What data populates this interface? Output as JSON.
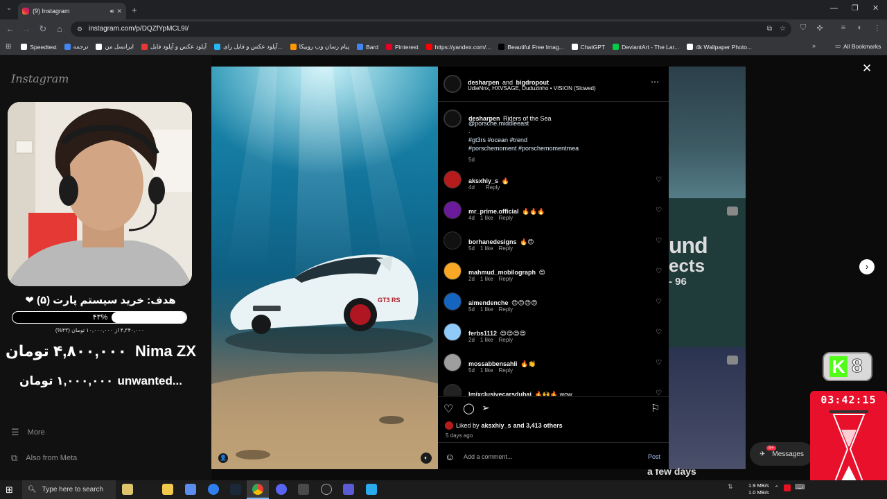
{
  "browser": {
    "tab_title": "(9) Instagram",
    "url": "instagram.com/p/DQZfYpMCL9I/",
    "bookmarks": [
      {
        "label": "Speedtest",
        "color": "#ffffff"
      },
      {
        "label": "ترجمه",
        "color": "#4285f4"
      },
      {
        "label": "ایرانسل من",
        "color": "#ffffff"
      },
      {
        "label": "آپلود عکس و آپلود فایل",
        "color": "#e53935"
      },
      {
        "label": "آپلود عکس و فایل رای...",
        "color": "#29b6f6"
      },
      {
        "label": "پیام رسان وب روبیکا",
        "color": "#ff9800"
      },
      {
        "label": "Bard",
        "color": "#4285f4"
      },
      {
        "label": "Pinterest",
        "color": "#e60023"
      },
      {
        "label": "https://yandex.com/...",
        "color": "#ff0000"
      },
      {
        "label": "Beautiful Free Imag...",
        "color": "#000000"
      },
      {
        "label": "ChatGPT",
        "color": "#ffffff"
      },
      {
        "label": "DeviantArt - The Lar...",
        "color": "#05cc47"
      },
      {
        "label": "4k Wallpaper Photo...",
        "color": "#ffffff"
      }
    ],
    "all_bookmarks_label": "All Bookmarks"
  },
  "instagram": {
    "logo_text": "Instagram",
    "sidebar": {
      "more_label": "More",
      "meta_label": "Also from Meta"
    },
    "post": {
      "header_users": "desharpen",
      "header_and": "and",
      "header_user2": "bigdropout",
      "audio_line": "UdieNnx, HXVSAGE, Duduzinho • VISION (Slowed)",
      "caption_user": "desharpen",
      "caption_text": "Riders of the Sea",
      "caption_mention": "@porsche.middleeast",
      "caption_dot": ".",
      "caption_tags1": "#gt3rs #ocean #trend",
      "caption_tags2": "#porschemoment #porschemomentmea",
      "caption_age": "5d",
      "comments": [
        {
          "user": "aksxhiy_s",
          "text": "🔥",
          "age": "4d",
          "likes": "",
          "reply": "Reply",
          "color": "#b71c1c"
        },
        {
          "user": "mr_prime.official",
          "text": "🔥🔥🔥",
          "age": "4d",
          "likes": "1 like",
          "reply": "Reply",
          "color": "#6a1b9a"
        },
        {
          "user": "borhanedesigns",
          "text": "🔥😍",
          "age": "5d",
          "likes": "1 like",
          "reply": "Reply",
          "color": "#111111"
        },
        {
          "user": "mahmud_mobilograph",
          "text": "😍",
          "age": "2d",
          "likes": "1 like",
          "reply": "Reply",
          "color": "#f9a825"
        },
        {
          "user": "aimendenche",
          "text": "😍😍😍😍",
          "age": "5d",
          "likes": "1 like",
          "reply": "Reply",
          "color": "#1565c0"
        },
        {
          "user": "ferbs1112",
          "text": "😍😍😍😍",
          "age": "2d",
          "likes": "1 like",
          "reply": "Reply",
          "color": "#90caf9"
        },
        {
          "user": "mossabbensahli",
          "text": "🔥👏",
          "age": "5d",
          "likes": "1 like",
          "reply": "Reply",
          "color": "#9e9e9e"
        },
        {
          "user": "lmjxclusivecarsdubai",
          "text": "🔥🙌🔥 wow",
          "age": "",
          "likes": "",
          "reply": "",
          "color": "#222222"
        }
      ],
      "liked_by_prefix": "Liked by",
      "liked_by_user": "aksxhiy_s",
      "liked_by_suffix": "and 3,413 others",
      "post_age": "5 days ago",
      "comment_placeholder": "Add a comment...",
      "post_button": "Post"
    },
    "bg_right": {
      "text1": "und",
      "text2": "ects",
      "text3": "- 96",
      "caption": "a few days",
      "messages_label": "Messages",
      "messages_badge": "9+"
    }
  },
  "stream_overlay": {
    "goal_title": "هدف: خرید سیستم پارت (۵) ❤",
    "goal_percent_label": "۴۳%",
    "goal_percent": 43,
    "goal_sub": "۴,۳۴۰,۰۰۰ از ۱۰,۰۰۰,۰۰۰ تومان (۴۳%)",
    "donor1_name": "Nima ZX",
    "donor1_amount": "۴,۸۰۰,۰۰۰ تومان",
    "donor2_name": "unwanted...",
    "donor2_amount": "۱,۰۰۰,۰۰۰ تومان",
    "kick_count": "8",
    "timer": "03:42:15"
  },
  "taskbar": {
    "search_placeholder": "Type here to search",
    "net_up": "1.9 MB/s",
    "net_down": "1.0 MB/s"
  }
}
